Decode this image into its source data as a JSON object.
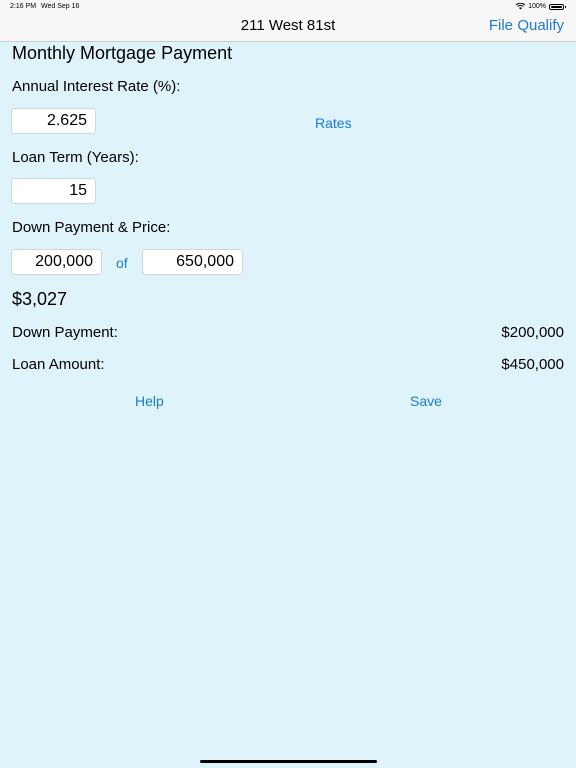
{
  "status": {
    "time": "2:16 PM",
    "date": "Wed Sep 16",
    "battery": "100%"
  },
  "nav": {
    "title": "211 West 81st",
    "file": "File",
    "qualify": "Qualify"
  },
  "section_title": "Monthly Mortgage Payment",
  "interest": {
    "label": "Annual Interest Rate (%):",
    "value": "2.625",
    "rates_link": "Rates"
  },
  "term": {
    "label": "Loan Term (Years):",
    "value": "15"
  },
  "down": {
    "label": "Down Payment & Price:",
    "down_value": "200,000",
    "of": "of",
    "price_value": "650,000"
  },
  "payment": {
    "value": "$3,027"
  },
  "summary": {
    "down_label": "Down Payment:",
    "down_value": "$200,000",
    "loan_label": "Loan Amount:",
    "loan_value": "$450,000"
  },
  "actions": {
    "help": "Help",
    "save": "Save"
  }
}
